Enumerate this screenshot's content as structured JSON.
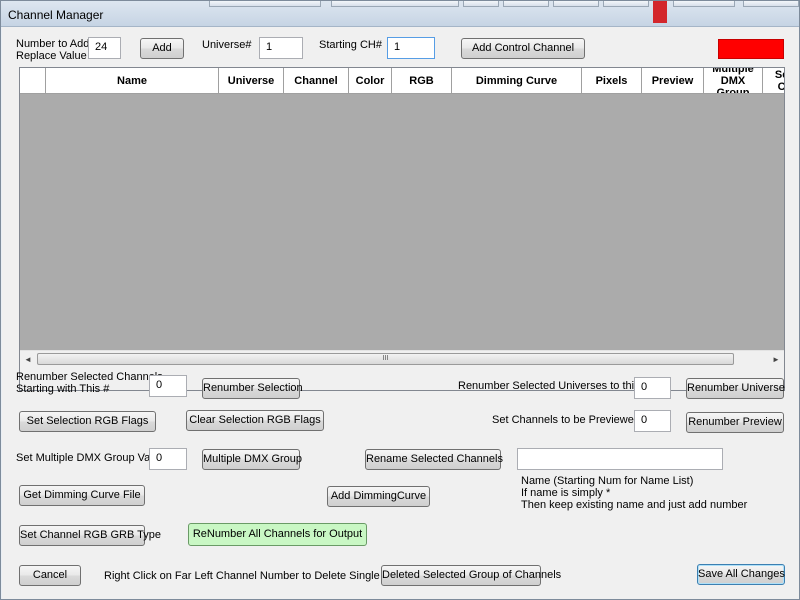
{
  "window": {
    "title": "Channel Manager"
  },
  "top": {
    "number_label": "Number to Add\nReplace Value",
    "number_value": "24",
    "add_button": "Add",
    "universe_label": "Universe#",
    "universe_value": "1",
    "starting_ch_label": "Starting CH#",
    "starting_ch_value": "1",
    "add_control_channel_button": "Add Control Channel",
    "color_swatch": "#ff0000"
  },
  "grid": {
    "columns": [
      "",
      "Name",
      "Universe",
      "Channel",
      "Color",
      "RGB",
      "Dimming Curve",
      "Pixels",
      "Preview",
      "Multiple DMX Group",
      "Seq Ch"
    ],
    "rows": [],
    "scrollbar_grip": "III"
  },
  "controls": {
    "renumber_selected_label": "Renumber Selected Channels\nStarting with This #",
    "renumber_selected_value": "0",
    "renumber_selection_button": "Renumber Selection",
    "renumber_universes_label": "Renumber Selected Universes to this #",
    "renumber_universes_value": "0",
    "renumber_universe_button": "Renumber Universe",
    "set_selection_rgb_button": "Set Selection RGB Flags",
    "clear_selection_rgb_button": "Clear Selection RGB Flags",
    "set_previewed_label": "Set Channels to be Previewed",
    "set_previewed_value": "0",
    "renumber_preview_button": "Renumber Preview",
    "set_multiple_dmx_label": "Set Multiple DMX Group Value",
    "multiple_dmx_value": "0",
    "multiple_dmx_button": "Multiple DMX Group",
    "rename_selected_button": "Rename Selected Channels",
    "rename_value": "",
    "get_dimming_curve_button": "Get Dimming Curve File",
    "add_dimming_curve_button": "Add DimmingCurve",
    "name_help_1": "Name (Starting Num for Name List)",
    "name_help_2": "If name is simply *",
    "name_help_3": "Then keep existing name and just add number",
    "set_rgb_grb_button": "Set Channel RGB GRB Type",
    "renumber_all_button": "ReNumber All Channels for Output",
    "cancel_button": "Cancel",
    "right_click_hint": "Right Click on Far Left Channel Number to Delete Single Channel",
    "delete_group_button": "Deleted Selected Group of Channels",
    "save_all_button": "Save All Changes"
  }
}
